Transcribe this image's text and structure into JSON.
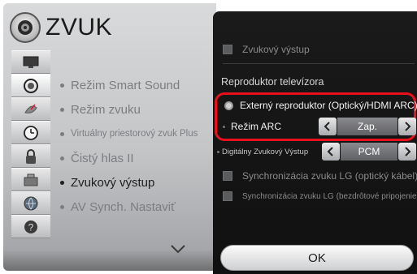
{
  "header": {
    "title": "ZVUK",
    "icon": "speaker-icon"
  },
  "side_icons": [
    {
      "name": "picture-icon"
    },
    {
      "name": "sound-icon"
    },
    {
      "name": "satellite-icon"
    },
    {
      "name": "clock-icon"
    },
    {
      "name": "lock-icon"
    },
    {
      "name": "options-icon"
    },
    {
      "name": "network-icon"
    },
    {
      "name": "support-icon"
    }
  ],
  "menu": {
    "items": [
      {
        "label": "Režim Smart Sound",
        "active": false
      },
      {
        "label": "Režim zvuku",
        "active": false
      },
      {
        "label": "Virtuálny priestorový zvuk Plus",
        "active": false
      },
      {
        "label": "Čistý hlas II",
        "active": false
      },
      {
        "label": "Zvukový výstup",
        "active": true
      },
      {
        "label": "AV Synch. Nastaviť",
        "active": false
      }
    ]
  },
  "popup": {
    "top_checkbox_label": "Zvukový výstup",
    "section_title": "Reproduktor televízora",
    "radio_label": "Externý reproduktor (Optický/HDMI ARC)",
    "arc_mode": {
      "label": "Režim ARC",
      "value": "Zap."
    },
    "digital_output": {
      "label": "Digitálny Zvukový Výstup",
      "value": "PCM"
    },
    "sync_optical_label": "Synchronizácia zvuku LG (optický kábel)",
    "sync_wireless_label": "Synchronizácia zvuku LG (bezdrôtové pripojenie)",
    "ok_label": "OK"
  },
  "colors": {
    "highlight": "#e8101a",
    "popup_bg": "#141414",
    "menu_bg": "#c4c5c7"
  }
}
